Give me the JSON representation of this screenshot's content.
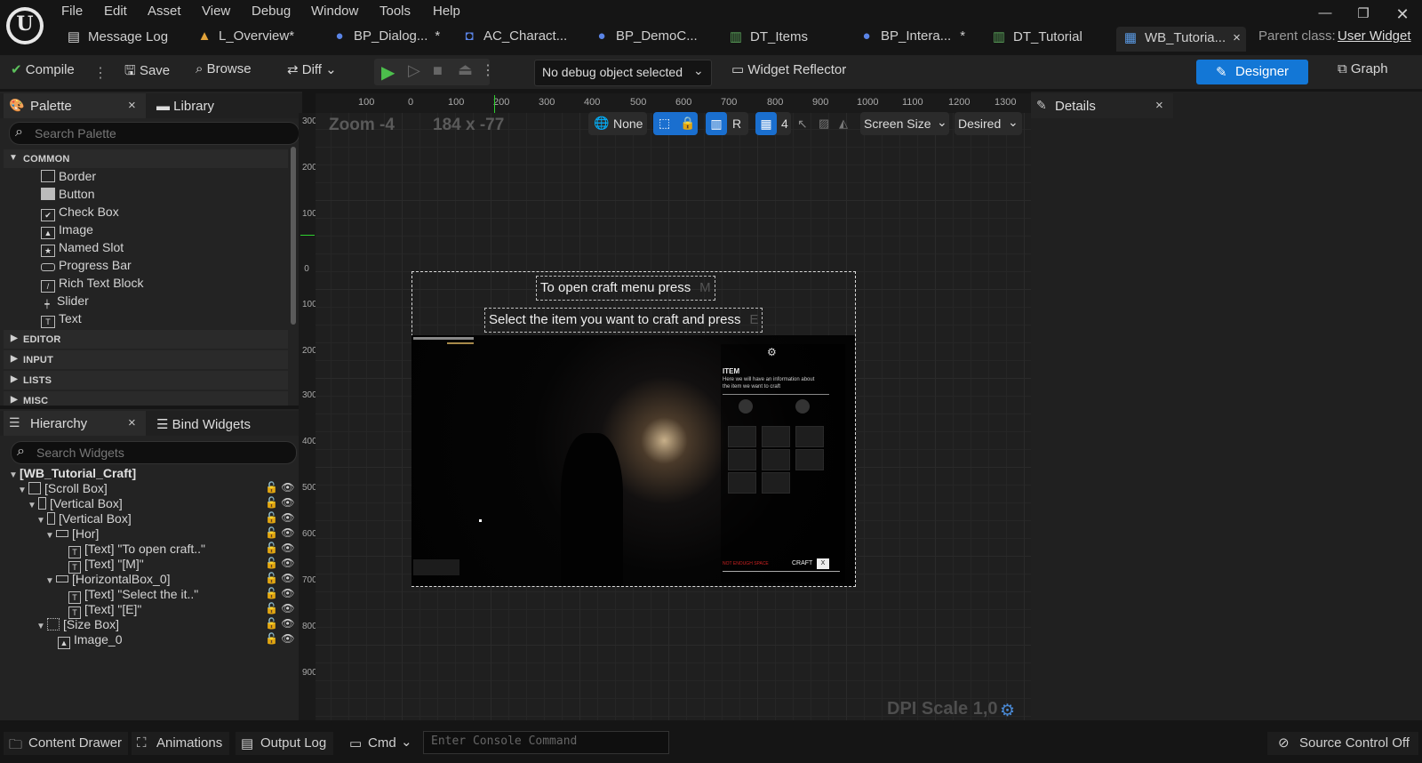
{
  "menu": [
    "File",
    "Edit",
    "Asset",
    "View",
    "Debug",
    "Window",
    "Tools",
    "Help"
  ],
  "tabs": [
    {
      "label": "Message Log",
      "icon": "bookmark-icon"
    },
    {
      "label": "L_Overview*",
      "icon": "level-icon"
    },
    {
      "label": "BP_Dialog...",
      "dirty": "*",
      "icon": "blueprint-actor-icon"
    },
    {
      "label": "AC_Charact...",
      "icon": "component-icon"
    },
    {
      "label": "BP_DemoC...",
      "icon": "blueprint-actor-icon"
    },
    {
      "label": "DT_Items",
      "icon": "datatable-icon"
    },
    {
      "label": "BP_Intera...",
      "dirty": "*",
      "icon": "blueprint-actor-icon"
    },
    {
      "label": "DT_Tutorial",
      "icon": "datatable-icon"
    },
    {
      "label": "WB_Tutoria...",
      "icon": "widget-blueprint-icon",
      "close": "×"
    }
  ],
  "parent_class": {
    "label": "Parent class:",
    "value": "User Widget"
  },
  "toolbar": {
    "compile": "Compile",
    "save": "Save",
    "browse": "Browse",
    "diff": "Diff",
    "debug_object": "No debug object selected",
    "widget_reflector": "Widget Reflector",
    "designer": "Designer",
    "graph": "Graph"
  },
  "palette": {
    "tab": "Palette",
    "close": "×",
    "library": "Library",
    "search_placeholder": "Search Palette",
    "categories_open": "COMMON",
    "items": [
      "Border",
      "Button",
      "Check Box",
      "Image",
      "Named Slot",
      "Progress Bar",
      "Rich Text Block",
      "Slider",
      "Text"
    ],
    "item_icons": [
      "border-icon",
      "button-icon",
      "checkbox-icon",
      "image-icon",
      "named-slot-icon",
      "progress-bar-icon",
      "rich-text-icon",
      "slider-icon",
      "text-icon"
    ],
    "categories_closed": [
      "EDITOR",
      "INPUT",
      "LISTS",
      "MISC"
    ]
  },
  "hierarchy": {
    "tab": "Hierarchy",
    "close": "×",
    "bind_widgets": "Bind Widgets",
    "search_placeholder": "Search Widgets",
    "root": "[WB_Tutorial_Craft]",
    "rows": [
      {
        "label": "[Scroll Box]",
        "depth": 1,
        "icon": "scroll-box-icon"
      },
      {
        "label": "[Vertical Box]",
        "depth": 2,
        "icon": "vertical-box-icon"
      },
      {
        "label": "[Vertical Box]",
        "depth": 3,
        "icon": "vertical-box-icon"
      },
      {
        "label": "[Hor]",
        "depth": 4,
        "icon": "horizontal-box-icon"
      },
      {
        "label": "[Text] \"To open craft..\"",
        "depth": 5,
        "icon": "text-icon"
      },
      {
        "label": "[Text] \"[M]\"",
        "depth": 5,
        "icon": "text-icon"
      },
      {
        "label": "[HorizontalBox_0]",
        "depth": 4,
        "icon": "horizontal-box-icon"
      },
      {
        "label": "[Text] \"Select the it..\"",
        "depth": 5,
        "icon": "text-icon"
      },
      {
        "label": "[Text] \"[E]\"",
        "depth": 5,
        "icon": "text-icon"
      },
      {
        "label": "[Size Box]",
        "depth": 3,
        "icon": "size-box-icon"
      },
      {
        "label": "Image_0",
        "depth": 4,
        "icon": "image-icon"
      }
    ]
  },
  "viewport": {
    "zoom": "Zoom -4",
    "coords": "184 x -77",
    "none": "None",
    "r": "R",
    "grid": "4",
    "screen_size": "Screen Size",
    "desired": "Desired",
    "dpi": "DPI Scale 1,0",
    "hruler": [
      "100",
      "0",
      "100",
      "200",
      "300",
      "400",
      "500",
      "600",
      "700",
      "800",
      "900",
      "1000",
      "1100",
      "1200",
      "1300"
    ],
    "vruler": [
      "300",
      "200",
      "100",
      "0",
      "100",
      "200",
      "300",
      "400",
      "500",
      "600",
      "700",
      "800",
      "900"
    ]
  },
  "widget": {
    "text1": "To open craft menu press",
    "key1": "M",
    "text2": "Select the item you want to craft and press",
    "key2": "E",
    "scene": {
      "item_title": "ITEM",
      "item_desc": "Here we will have an information about the item we want to craft",
      "not_enough": "NOT ENOUGH SPACE",
      "craft": "CRAFT",
      "craft_key": "X"
    }
  },
  "details": {
    "tab": "Details",
    "close": "×"
  },
  "statusbar": {
    "content_drawer": "Content Drawer",
    "animations": "Animations",
    "output_log": "Output Log",
    "cmd": "Cmd",
    "console_placeholder": "Enter Console Command",
    "source_control": "Source Control Off"
  },
  "colors": {
    "accent": "#1377d6",
    "background": "#151515",
    "panel": "#232323",
    "viewport": "#1f1f1f"
  }
}
